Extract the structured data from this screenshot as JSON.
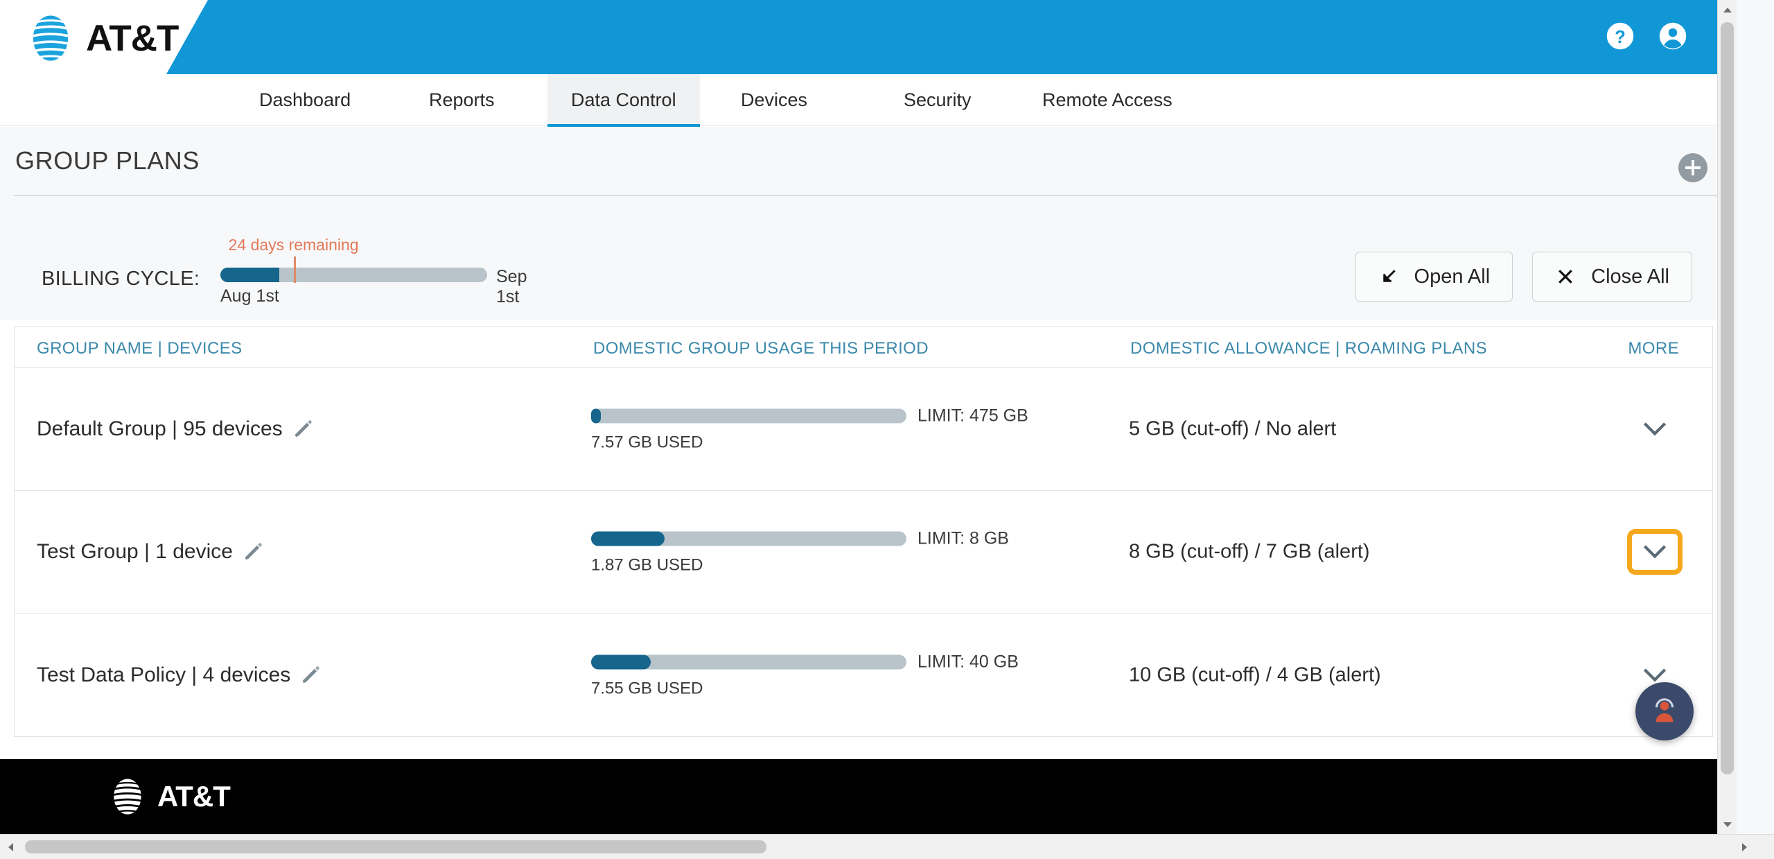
{
  "brand": {
    "name": "AT&T",
    "header_blue": "#1197d5",
    "accent_dark_blue": "#15658c",
    "focus_orange": "#f5a81c",
    "link_teal": "#3c89ab"
  },
  "header": {
    "help_icon": "help-circle-icon",
    "account_icon": "account-circle-icon"
  },
  "nav": {
    "tabs": [
      {
        "label": "Dashboard",
        "active": false
      },
      {
        "label": "Reports",
        "active": false
      },
      {
        "label": "Data Control",
        "active": true
      },
      {
        "label": "Devices",
        "active": false
      },
      {
        "label": "Security",
        "active": false
      },
      {
        "label": "Remote Access",
        "active": false
      }
    ]
  },
  "page": {
    "title": "GROUP PLANS",
    "add_icon": "plus-circle-icon"
  },
  "billing": {
    "label": "BILLING CYCLE:",
    "start_date": "Aug 1st",
    "end_date": "Sep 1st",
    "remaining": "24 days remaining",
    "progress_percent": 22,
    "open_all": "Open All",
    "close_all": "Close All",
    "open_all_icon": "arrow-down-left-icon",
    "close_all_icon": "close-x-icon"
  },
  "table": {
    "columns": [
      "GROUP NAME | DEVICES",
      "DOMESTIC GROUP USAGE THIS PERIOD",
      "DOMESTIC ALLOWANCE | ROAMING PLANS",
      "MORE"
    ],
    "rows": [
      {
        "group_name": "Default Group | 95 devices",
        "edit_icon": "pencil-edit-icon",
        "used_label": "7.57 GB USED",
        "limit_label": "LIMIT: 475 GB",
        "used_gb": 7.57,
        "limit_gb": 475,
        "fill_percent": 1.6,
        "allowance": "5 GB (cut-off) / No alert",
        "more_icon": "chevron-down-icon",
        "focused": false
      },
      {
        "group_name": "Test Group | 1 device",
        "edit_icon": "pencil-edit-icon",
        "used_label": "1.87 GB USED",
        "limit_label": "LIMIT: 8 GB",
        "used_gb": 1.87,
        "limit_gb": 8,
        "fill_percent": 23.4,
        "allowance": "8 GB (cut-off) / 7 GB (alert)",
        "more_icon": "chevron-down-icon",
        "focused": true
      },
      {
        "group_name": "Test Data Policy | 4 devices",
        "edit_icon": "pencil-edit-icon",
        "used_label": "7.55 GB USED",
        "limit_label": "LIMIT: 40 GB",
        "used_gb": 7.55,
        "limit_gb": 40,
        "fill_percent": 18.9,
        "allowance": "10 GB (cut-off) / 4 GB (alert)",
        "more_icon": "chevron-down-icon",
        "focused": false
      }
    ]
  },
  "footer": {
    "logo_text": "AT&T"
  },
  "fab": {
    "icon": "support-agent-icon"
  },
  "scrollbars": {
    "vertical_icon_up": "scroll-up-arrow-icon",
    "vertical_icon_down": "scroll-down-arrow-icon",
    "horizontal_icon_left": "scroll-left-arrow-icon",
    "horizontal_icon_right": "scroll-right-arrow-icon"
  }
}
